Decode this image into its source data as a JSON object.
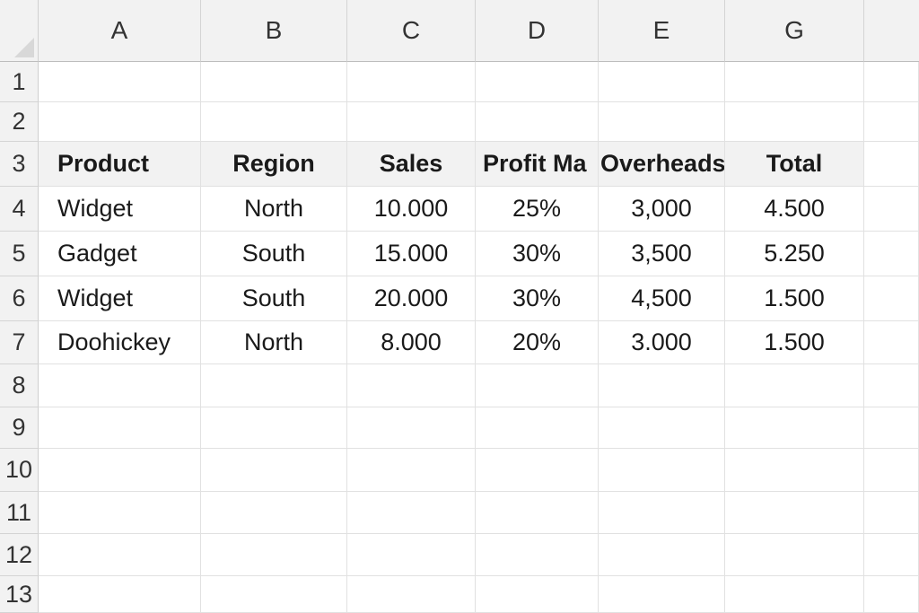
{
  "columns": [
    "A",
    "B",
    "C",
    "D",
    "E",
    "G"
  ],
  "rows": [
    "1",
    "2",
    "3",
    "4",
    "5",
    "6",
    "7",
    "8",
    "9",
    "10",
    "11",
    "12",
    "13"
  ],
  "table": {
    "headers": [
      "Product",
      "Region",
      "Sales",
      "Profit Ma",
      "Overheads",
      "Total"
    ],
    "data": [
      [
        "Widget",
        "North",
        "10.000",
        "25%",
        "3,000",
        "4.500"
      ],
      [
        "Gadget",
        "South",
        "15.000",
        "30%",
        "3,500",
        "5.250"
      ],
      [
        "Widget",
        "South",
        "20.000",
        "30%",
        "4,500",
        "1.500"
      ],
      [
        "Doohickey",
        "North",
        "8.000",
        "20%",
        "3.000",
        "1.500"
      ]
    ]
  },
  "colors": {
    "header_bg": "#f2f2f2",
    "gridline": "#e1e1e1"
  }
}
